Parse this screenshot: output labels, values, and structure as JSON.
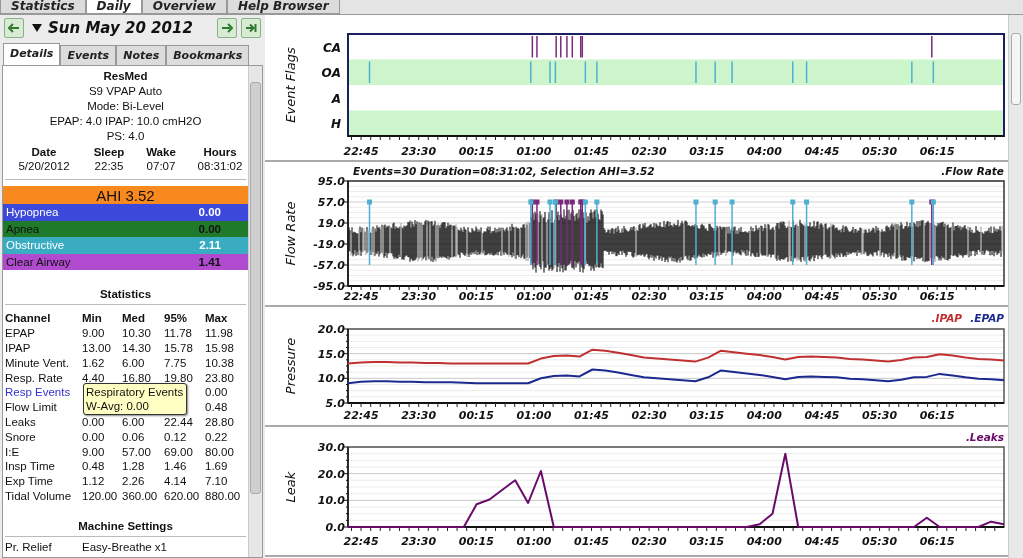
{
  "main_tabs": [
    {
      "label": "Statistics",
      "selected": false
    },
    {
      "label": "Daily",
      "selected": true
    },
    {
      "label": "Overview",
      "selected": false
    },
    {
      "label": "Help Browser",
      "selected": false
    }
  ],
  "date_nav": {
    "date": "Sun May 20 2012"
  },
  "detail_tabs": [
    {
      "label": "Details",
      "selected": true
    },
    {
      "label": "Events",
      "selected": false
    },
    {
      "label": "Notes",
      "selected": false
    },
    {
      "label": "Bookmarks",
      "selected": false
    }
  ],
  "machine_lines": [
    {
      "text": "ResMed",
      "kind": "brand"
    },
    {
      "text": "S9 VPAP Auto",
      "kind": "line"
    },
    {
      "text": "Mode: Bi-Level",
      "kind": "line"
    },
    {
      "text": "EPAP: 4.0 IPAP: 10.0 cmH2O",
      "kind": "line"
    },
    {
      "text": "PS: 4.0",
      "kind": "line"
    }
  ],
  "session": {
    "columns": [
      "Date",
      "Sleep",
      "Wake",
      "Hours"
    ],
    "values": [
      "5/20/2012",
      "22:35",
      "07:07",
      "08:31:02"
    ]
  },
  "event_indices": [
    {
      "kind": "total",
      "label": "AHI 3.52",
      "color": "#f7891f"
    },
    {
      "kind": "row",
      "label": "Hypopnea",
      "value": "0.00",
      "color": "#3b48d9"
    },
    {
      "kind": "row",
      "label": "Apnea",
      "value": "0.00",
      "color": "#1f7a2b"
    },
    {
      "kind": "row",
      "label": "Obstructive",
      "value": "2.11",
      "color": "#3aacc2"
    },
    {
      "kind": "row",
      "label": "Clear Airway",
      "value": "1.41",
      "color": "#b04bcf"
    }
  ],
  "statistics": {
    "title": "Statistics",
    "columns": [
      "Channel",
      "Min",
      "Med",
      "95%",
      "Max"
    ],
    "rows": [
      {
        "channel": "EPAP",
        "highlighted": false,
        "min": "9.00",
        "med": "10.30",
        "p95": "11.78",
        "max": "11.98"
      },
      {
        "channel": "IPAP",
        "highlighted": false,
        "min": "13.00",
        "med": "14.30",
        "p95": "15.78",
        "max": "15.98"
      },
      {
        "channel": "Minute Vent.",
        "highlighted": false,
        "min": "1.62",
        "med": "6.00",
        "p95": "7.75",
        "max": "10.38"
      },
      {
        "channel": "Resp. Rate",
        "highlighted": false,
        "min": "4.40",
        "med": "16.80",
        "p95": "19.80",
        "max": "23.80"
      },
      {
        "channel": "Resp Events",
        "highlighted": true,
        "max": "0.00"
      },
      {
        "channel": "Flow Limit",
        "highlighted": false,
        "max": "0.48"
      },
      {
        "channel": "Leaks",
        "highlighted": false,
        "min": "0.00",
        "med": "6.00",
        "p95": "22.44",
        "max": "28.80"
      },
      {
        "channel": "Snore",
        "highlighted": false,
        "min": "0.00",
        "med": "0.06",
        "p95": "0.12",
        "max": "0.22"
      },
      {
        "channel": "I:E",
        "highlighted": false,
        "min": "9.00",
        "med": "57.00",
        "p95": "69.00",
        "max": "80.00"
      },
      {
        "channel": "Insp Time",
        "highlighted": false,
        "min": "0.48",
        "med": "1.28",
        "p95": "1.46",
        "max": "1.69"
      },
      {
        "channel": "Exp Time",
        "highlighted": false,
        "min": "1.12",
        "med": "2.26",
        "p95": "4.14",
        "max": "7.10"
      },
      {
        "channel": "Tidal Volume",
        "highlighted": false,
        "min": "120.00",
        "med": "360.00",
        "p95": "620.00",
        "max": "880.00"
      }
    ]
  },
  "tooltip": {
    "lines": [
      "Respiratory Events",
      "W-Avg: 0.00"
    ]
  },
  "machine_settings": {
    "title": "Machine Settings",
    "rows": [
      {
        "name": "Pr. Relief",
        "value": "Easy-Breathe x1"
      }
    ]
  },
  "charts": [
    {
      "kind": "flags",
      "ylabel": "Event Flags",
      "lanes": [
        "CA",
        "OA",
        "A",
        "H"
      ],
      "x_axis_labels": [
        "22:45",
        "23:30",
        "00:15",
        "01:00",
        "01:45",
        "02:30",
        "03:15",
        "04:00",
        "04:45",
        "05:30",
        "06:15"
      ]
    },
    {
      "kind": "flow",
      "ylabel": "Flow Rate",
      "title": "Events=30 Duration=08:31:02, Selection AHI=3.52",
      "legend": [
        ".Flow Rate"
      ],
      "y_axis_labels": [
        "95.0",
        "57.0",
        "19.0",
        "-19.0",
        "-57.0",
        "-95.0"
      ],
      "x_axis_labels": [
        "22:45",
        "23:30",
        "00:15",
        "01:00",
        "01:45",
        "02:30",
        "03:15",
        "04:00",
        "04:45",
        "05:30",
        "06:15"
      ]
    },
    {
      "x_axis_labels": [
        "22:45",
        "23:30",
        "00:15",
        "01:00",
        "01:45",
        "02:30",
        "03:15",
        "04:00",
        "04:45",
        "05:30",
        "06:15"
      ],
      "chart_data": {
        "type": "line",
        "ylabel": "Pressure",
        "ylim": [
          5,
          20
        ],
        "yticks": [
          {
            "value": 5,
            "label": "5.0"
          },
          {
            "value": 10,
            "label": "10.0"
          },
          {
            "value": 15,
            "label": "15.0"
          },
          {
            "value": 20,
            "label": "20.0"
          }
        ],
        "series": [
          {
            "name": ".IPAP",
            "color": "#c03030",
            "values": [
              13.0,
              13.2,
              13.3,
              13.3,
              13.2,
              13.2,
              13.1,
              13.1,
              13.0,
              13.0,
              13.0,
              13.0,
              13.0,
              13.0,
              13.0,
              14.0,
              14.5,
              14.6,
              14.4,
              15.8,
              15.6,
              15.2,
              14.7,
              14.2,
              14.0,
              13.8,
              13.6,
              13.4,
              14.2,
              15.6,
              15.3,
              15.0,
              14.7,
              14.3,
              13.8,
              14.3,
              14.4,
              14.3,
              14.2,
              13.9,
              13.8,
              13.6,
              13.4,
              13.7,
              14.2,
              14.3,
              14.9,
              14.6,
              14.2,
              13.9,
              13.8,
              13.6
            ]
          },
          {
            "name": ".EPAP",
            "color": "#1c2a90",
            "values": [
              9.0,
              9.3,
              9.4,
              9.4,
              9.3,
              9.3,
              9.2,
              9.2,
              9.2,
              9.1,
              9.0,
              9.0,
              9.0,
              9.0,
              9.0,
              10.0,
              10.5,
              10.6,
              10.4,
              11.8,
              11.6,
              11.2,
              10.7,
              10.2,
              10.0,
              9.8,
              9.6,
              9.4,
              10.2,
              11.6,
              11.3,
              11.0,
              10.7,
              10.3,
              9.8,
              10.3,
              10.4,
              10.3,
              10.2,
              9.9,
              9.8,
              9.6,
              9.4,
              9.7,
              10.2,
              10.3,
              10.9,
              10.6,
              10.2,
              9.9,
              9.8,
              9.6
            ]
          }
        ]
      }
    },
    {
      "x_axis_labels": [
        "22:45",
        "23:30",
        "00:15",
        "01:00",
        "01:45",
        "02:30",
        "03:15",
        "04:00",
        "04:45",
        "05:30",
        "06:15"
      ],
      "chart_data": {
        "type": "line",
        "ylabel": "Leak",
        "ylim": [
          0,
          30
        ],
        "yticks": [
          {
            "value": 0,
            "label": "0.0"
          },
          {
            "value": 10,
            "label": "10.0"
          },
          {
            "value": 20,
            "label": "20.0"
          },
          {
            "value": 30,
            "label": "30.0"
          }
        ],
        "series": [
          {
            "name": ".Leaks",
            "color": "#6a0a6a",
            "values": [
              0,
              0,
              0,
              0,
              0,
              0,
              0,
              0,
              0,
              0,
              8.5,
              10.3,
              14,
              17.5,
              9,
              21,
              0,
              0,
              0,
              0,
              0,
              0,
              0,
              0,
              0,
              0,
              0,
              0,
              0,
              0,
              0,
              0,
              1,
              5,
              27.5,
              0,
              0,
              0,
              0,
              0,
              0,
              0,
              0,
              0,
              0,
              3.5,
              0,
              0,
              0,
              0,
              2,
              1
            ]
          }
        ]
      }
    }
  ]
}
